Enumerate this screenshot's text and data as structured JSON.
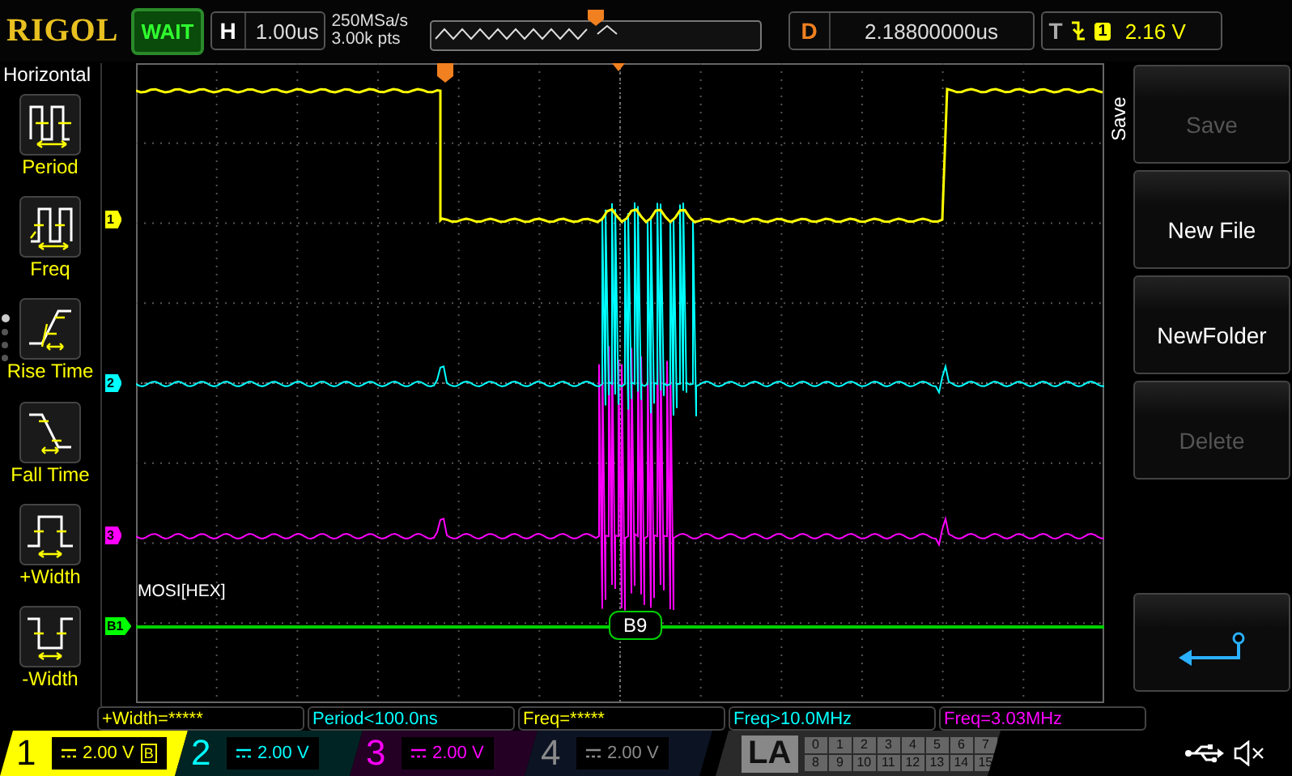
{
  "header": {
    "logo": "RIGOL",
    "run_status": "WAIT",
    "horizontal": {
      "label": "H",
      "value": "1.00us"
    },
    "sample_rate": "250MSa/s",
    "memory_depth": "3.00k pts",
    "delay": {
      "label": "D",
      "value": "2.18800000us"
    },
    "trigger": {
      "label": "T",
      "source": "1",
      "level": "2.16 V"
    }
  },
  "measure_menu": {
    "title": "Horizontal",
    "items": [
      {
        "kind": "period",
        "label": "Period"
      },
      {
        "kind": "freq",
        "label": "Freq"
      },
      {
        "kind": "rise",
        "label": "Rise Time"
      },
      {
        "kind": "fall",
        "label": "Fall Time"
      },
      {
        "kind": "pwidth",
        "label": "+Width"
      },
      {
        "kind": "nwidth",
        "label": "-Width"
      }
    ],
    "pages": [
      {
        "selected": true
      },
      {
        "selected": false
      },
      {
        "selected": false
      },
      {
        "selected": false
      }
    ]
  },
  "waveform": {
    "markers": [
      {
        "label": "1",
        "color": "#ffff00"
      },
      {
        "label": "2",
        "color": "#00ffff"
      },
      {
        "label": "3",
        "color": "#ff00ff"
      },
      {
        "label": "B1",
        "color": "#00ff00"
      }
    ],
    "decode_label": "MOSI[HEX]",
    "decode_value": "B9"
  },
  "save_menu": {
    "title": "Save",
    "buttons": [
      {
        "kind": "text",
        "label": "Save",
        "disabled": true
      },
      {
        "kind": "text",
        "label": "New File",
        "disabled": false
      },
      {
        "kind": "text",
        "label": "NewFolder",
        "disabled": false
      },
      {
        "kind": "text",
        "label": "Delete",
        "disabled": true
      },
      {
        "kind": "back"
      }
    ]
  },
  "measurements": [
    {
      "text": "+Width=*****",
      "color": "#ffff00"
    },
    {
      "text": "Period<100.0ns",
      "color": "#00ffff"
    },
    {
      "text": "Freq=*****",
      "color": "#ffff00"
    },
    {
      "text": "Freq>10.0MHz",
      "color": "#00ffff"
    },
    {
      "text": "Freq=3.03MHz",
      "color": "#ff00ff"
    }
  ],
  "channels": [
    {
      "number": "1",
      "scale": "2.00 V",
      "color": "#ffff00",
      "enabled": true,
      "selected": true,
      "bw_limit": "B"
    },
    {
      "number": "2",
      "scale": "2.00 V",
      "color": "#00ffff",
      "enabled": true,
      "selected": false
    },
    {
      "number": "3",
      "scale": "2.00 V",
      "color": "#ff00ff",
      "enabled": true,
      "selected": false
    },
    {
      "number": "4",
      "scale": "2.00 V",
      "color": "#8a8a8a",
      "enabled": false,
      "selected": false
    }
  ],
  "logic_analyzer": {
    "label": "LA",
    "channels": [
      "0",
      "1",
      "2",
      "3",
      "4",
      "5",
      "6",
      "7",
      "8",
      "9",
      "10",
      "11",
      "12",
      "13",
      "14",
      "15"
    ]
  }
}
